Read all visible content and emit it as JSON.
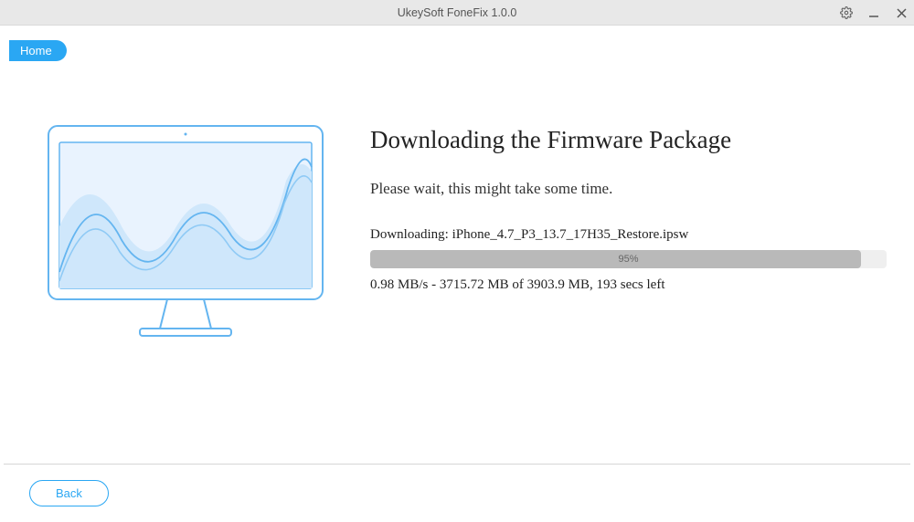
{
  "window": {
    "title": "UkeySoft FoneFix 1.0.0"
  },
  "nav": {
    "home": "Home"
  },
  "main": {
    "heading": "Downloading the Firmware Package",
    "subheading": "Please wait, this might take some time.",
    "download_label": "Downloading: iPhone_4.7_P3_13.7_17H35_Restore.ipsw",
    "progress_percent": "95%",
    "progress_value": 95,
    "stats": "0.98 MB/s - 3715.72 MB of 3903.9 MB, 193 secs left"
  },
  "footer": {
    "back": "Back"
  }
}
